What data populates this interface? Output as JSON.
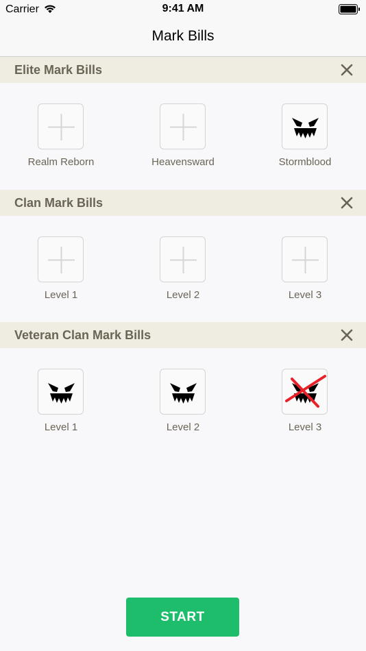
{
  "status_bar": {
    "carrier": "Carrier",
    "time": "9:41 AM"
  },
  "nav": {
    "title": "Mark Bills"
  },
  "sections": [
    {
      "title": "Elite Mark Bills",
      "bills": [
        {
          "label": "Realm Reborn",
          "state": "empty"
        },
        {
          "label": "Heavensward",
          "state": "empty"
        },
        {
          "label": "Stormblood",
          "state": "active"
        }
      ]
    },
    {
      "title": "Clan Mark Bills",
      "bills": [
        {
          "label": "Level 1",
          "state": "empty"
        },
        {
          "label": "Level 2",
          "state": "empty"
        },
        {
          "label": "Level 3",
          "state": "empty"
        }
      ]
    },
    {
      "title": "Veteran Clan Mark Bills",
      "bills": [
        {
          "label": "Level 1",
          "state": "active"
        },
        {
          "label": "Level 2",
          "state": "active"
        },
        {
          "label": "Level 3",
          "state": "completed"
        }
      ]
    }
  ],
  "icons": {
    "empty": "plus-icon",
    "active": "monster-face-icon",
    "completed": "crossed-monster-face-icon",
    "close": "close-icon"
  },
  "colors": {
    "header_bg": "#efede2",
    "header_text": "#6a6455",
    "start_button": "#1dbd6b",
    "cross_red": "#e8202a"
  },
  "start_button": {
    "label": "START"
  }
}
